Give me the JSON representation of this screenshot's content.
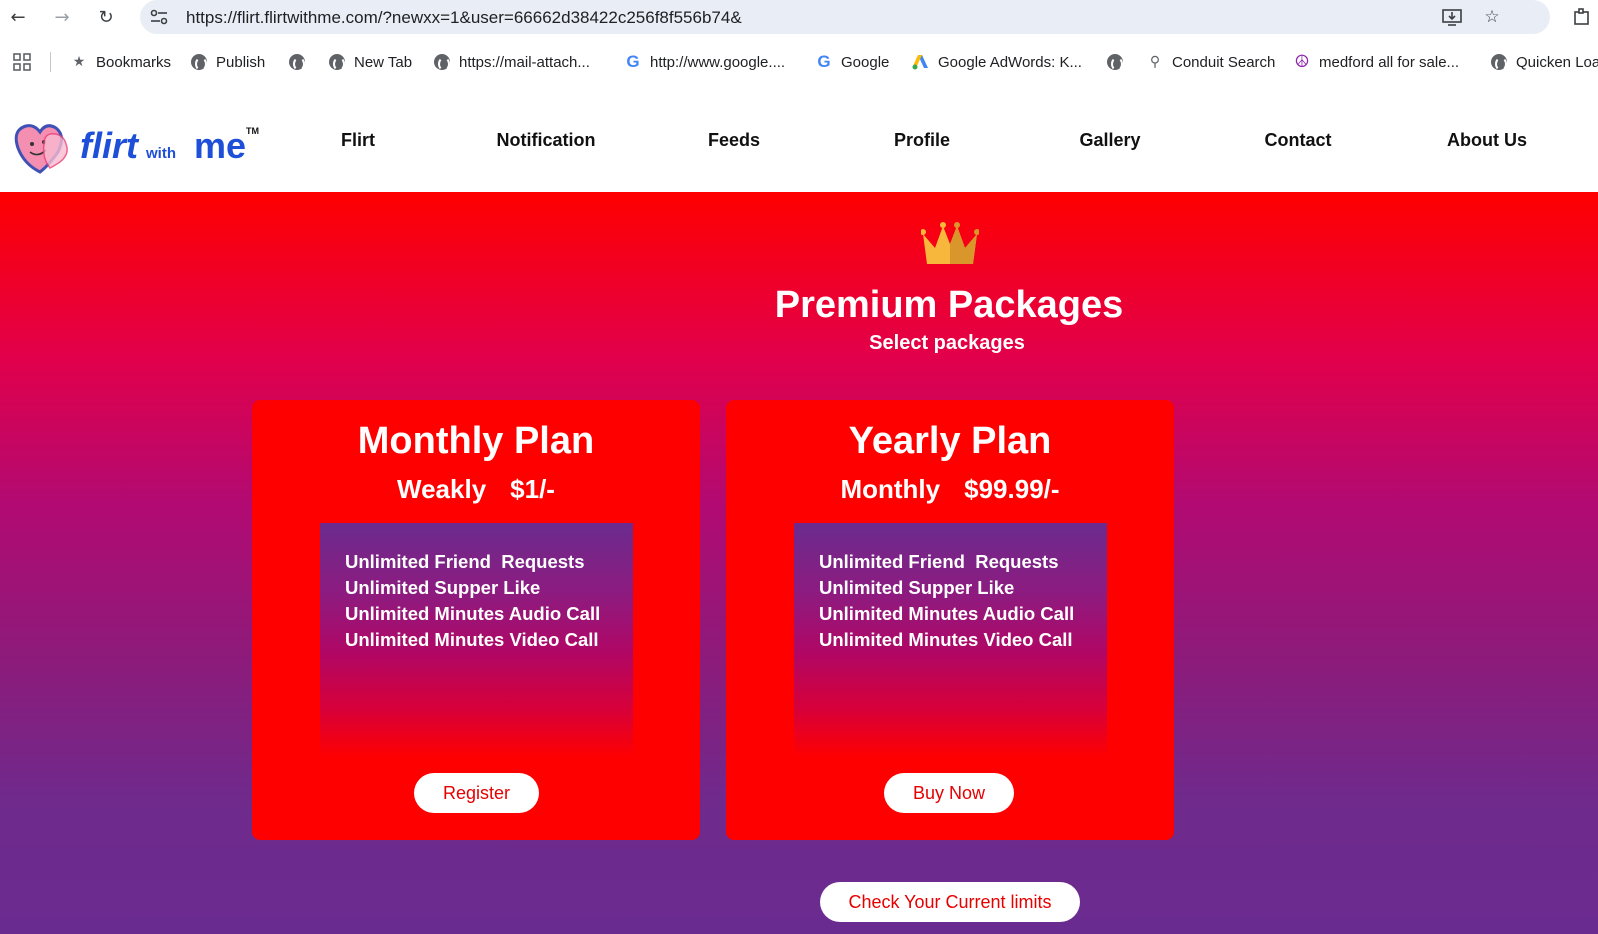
{
  "browser": {
    "url": "https://flirt.flirtwithme.com/?newxx=1&user=66662d38422c256f8f556b74&",
    "bookmarks": [
      {
        "label": "Bookmarks",
        "icon": "star-icon"
      },
      {
        "label": "Publish",
        "icon": "globe-icon"
      },
      {
        "label": "",
        "icon": "globe-icon"
      },
      {
        "label": "New Tab",
        "icon": "globe-icon"
      },
      {
        "label": "https://mail-attach...",
        "icon": "globe-icon"
      },
      {
        "label": "http://www.google....",
        "icon": "google-icon"
      },
      {
        "label": "Google",
        "icon": "google-icon"
      },
      {
        "label": "Google AdWords: K...",
        "icon": "adwords-icon"
      },
      {
        "label": "",
        "icon": "globe-icon"
      },
      {
        "label": "Conduit Search",
        "icon": "search-icon"
      },
      {
        "label": "medford all for sale...",
        "icon": "peace-icon"
      },
      {
        "label": "Quicken Loa",
        "icon": "globe-icon"
      }
    ]
  },
  "site": {
    "logo_text": {
      "main": "flirt",
      "small": "with",
      "end": "me",
      "tm": "TM"
    },
    "nav": [
      "Flirt",
      "Notification",
      "Feeds",
      "Profile",
      "Gallery",
      "Contact",
      "About Us"
    ]
  },
  "main": {
    "title": "Premium Packages",
    "subtitle": "Select packages",
    "plans": [
      {
        "title": "Monthly Plan",
        "period": "Weakly",
        "price": "$1/-",
        "features": [
          "Unlimited Friend  Requests",
          "Unlimited Supper Like",
          "Unlimited Minutes Audio Call",
          "Unlimited Minutes Video Call"
        ],
        "button": "Register"
      },
      {
        "title": "Yearly Plan",
        "period": "Monthly",
        "price": "$99.99/-",
        "features": [
          "Unlimited Friend  Requests",
          "Unlimited Supper Like",
          "Unlimited Minutes Audio Call",
          "Unlimited Minutes Video Call"
        ],
        "button": "Buy Now"
      }
    ],
    "check_button": "Check Your Current limits"
  },
  "colors": {
    "brand_red": "#ff0000",
    "brand_purple": "#6a2b90",
    "button_text": "#e60000"
  }
}
